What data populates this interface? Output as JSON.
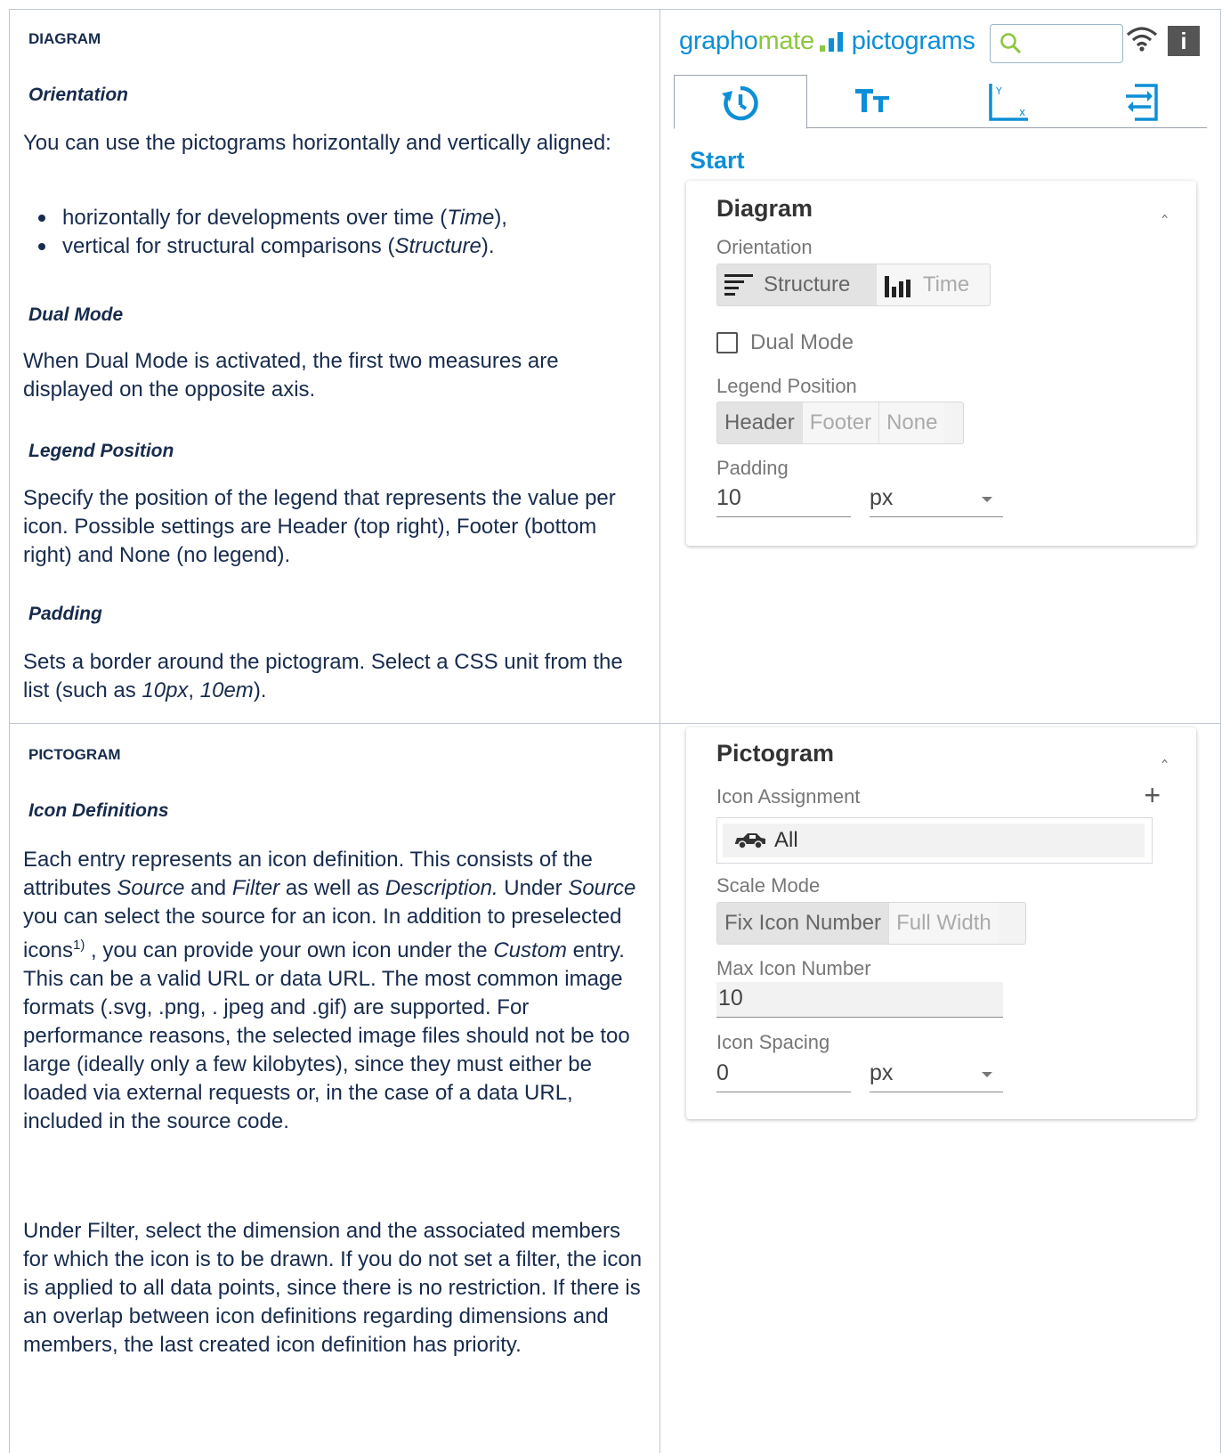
{
  "diagram_doc": {
    "section_title": "DIAGRAM",
    "orientation_heading": "Orientation",
    "orientation_text": "You can use the pictograms horizontally and vertically aligned:",
    "bullets": [
      {
        "before": "horizontally for developments over time (",
        "em": "Time",
        "after": "),"
      },
      {
        "before": "vertical for structural comparisons (",
        "em": "Structure",
        "after": ")."
      }
    ],
    "dual_heading": "Dual Mode",
    "dual_text": "When Dual Mode is activated, the first two measures are displayed on the opposite axis.",
    "legend_heading": "Legend Position",
    "legend_text": "Specify the position of the legend that represents the value per icon. Possible settings are Header (top right), Footer (bottom right) and None (no legend).",
    "padding_heading": "Padding",
    "padding_text_before": "Sets a border around the pictogram. Select a CSS unit from the list (such as ",
    "padding_em1": "10px",
    "padding_sep": ", ",
    "padding_em2": "10em",
    "padding_after": ")."
  },
  "pictogram_doc": {
    "section_title": "PICTOGRAM",
    "icon_heading": "Icon Definitions",
    "p1": {
      "t1": "Each entry represents an icon definition. This consists of the attributes ",
      "e1": "Source",
      "t2": " and ",
      "e2": "Filter",
      "t3": " as well as ",
      "e3": "Description.",
      "t4": " Under ",
      "e4": "Source",
      "t5": " you can select the source for an icon. In addition to preselected icons",
      "sup": "1)",
      "t6": " , you can provide your own icon under the ",
      "e5": "Custom",
      "t7": " entry. This can be a valid URL or data URL. The most common image formats (.svg, .png, . jpeg and .gif) are supported. For performance reasons, the selected image files should not be too large (ideally only a few kilobytes), since they must either be loaded via external requests or, in the case of a data URL, included in the source code."
    },
    "p2": "Under Filter, select the dimension and the associated members for which the icon is to be drawn. If you do not set a filter, the icon is applied to all data points, since there is no restriction. If there is an overlap between icon definitions regarding dimensions and members, the last created icon definition has priority."
  },
  "panel": {
    "brand_part1": "grapho",
    "brand_part2": "mate",
    "brand_part3": "pictograms",
    "info_label": "i",
    "start_label": "Start",
    "diagram_card": {
      "title": "Diagram",
      "orientation_label": "Orientation",
      "orientation_options": [
        "Structure",
        "Time"
      ],
      "dual_label": "Dual Mode",
      "legend_label": "Legend Position",
      "legend_options": [
        "Header",
        "Footer",
        "None"
      ],
      "padding_label": "Padding",
      "padding_value": "10",
      "padding_unit": "px"
    },
    "pictogram_card": {
      "title": "Pictogram",
      "assign_label": "Icon Assignment",
      "assign_value": "All",
      "scale_label": "Scale Mode",
      "scale_options": [
        "Fix Icon Number",
        "Full Width"
      ],
      "max_label": "Max Icon Number",
      "max_value": "10",
      "spacing_label": "Icon Spacing",
      "spacing_value": "0",
      "spacing_unit": "px"
    }
  },
  "colors": {
    "brand_blue": "#0d8fd7",
    "brand_green": "#8dc63f",
    "text": "#172b4d"
  }
}
